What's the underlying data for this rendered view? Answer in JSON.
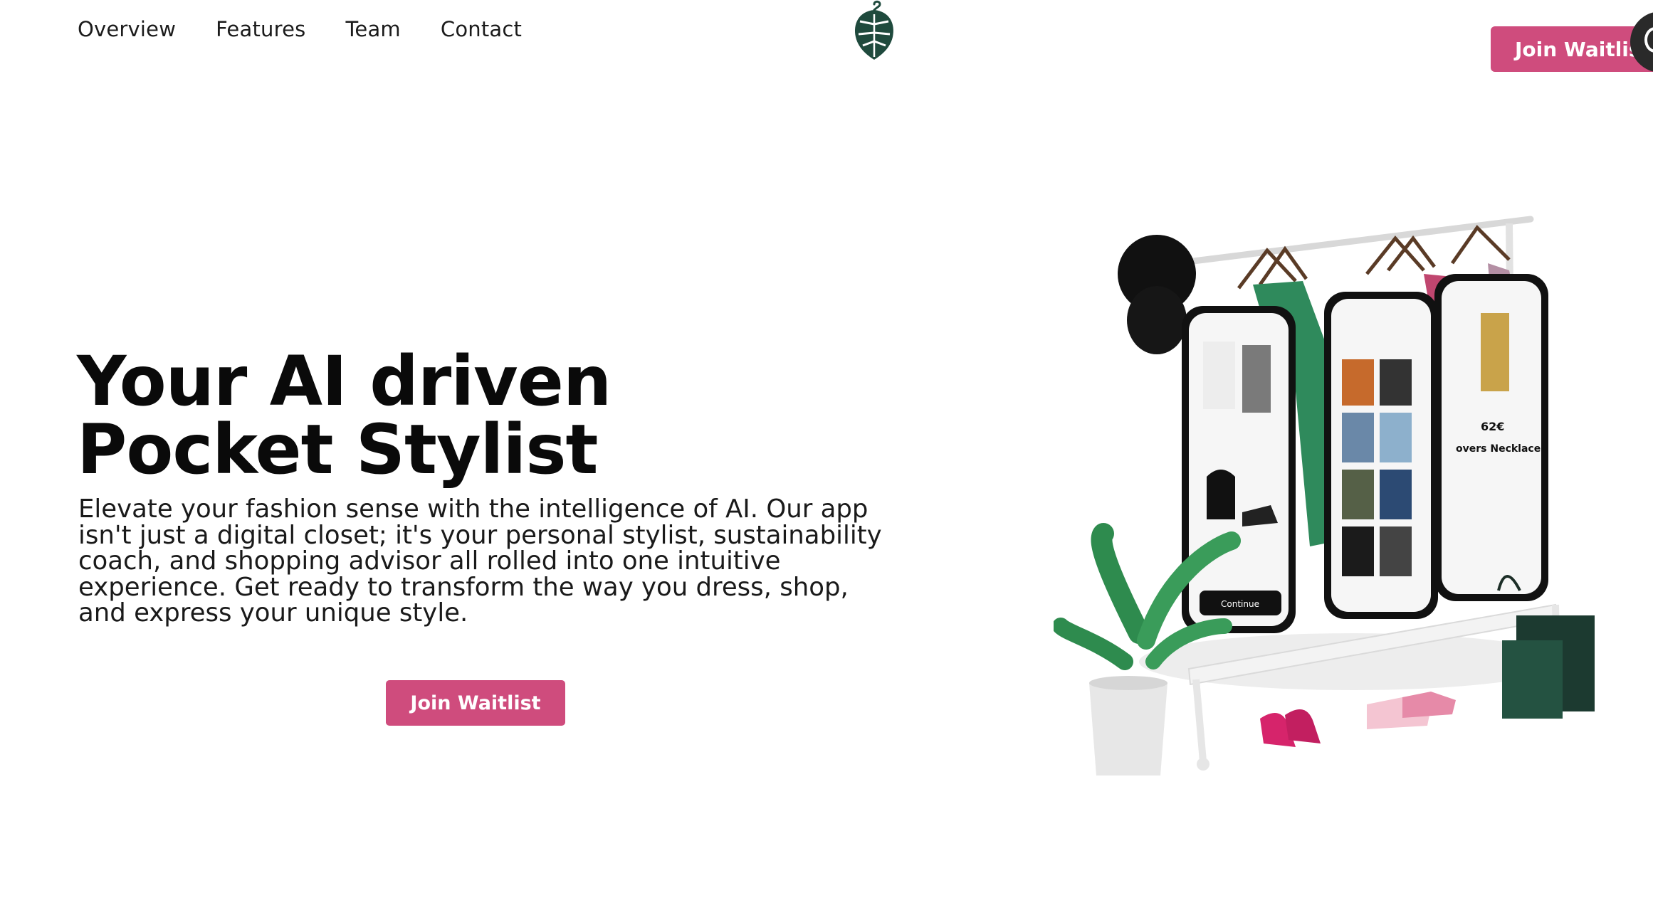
{
  "nav": {
    "items": [
      {
        "label": "Overview"
      },
      {
        "label": "Features"
      },
      {
        "label": "Team"
      },
      {
        "label": "Contact"
      }
    ]
  },
  "header": {
    "cta_label": "Join Waitlist"
  },
  "hero": {
    "title_line1": "Your AI driven",
    "title_line2": "Pocket Stylist",
    "description": "Elevate your fashion sense with the intelligence of AI. Our app isn't just a digital closet; it's your personal stylist, sustainability coach, and shopping advisor all rolled into one intuitive experience. Get ready to transform the way you dress, shop, and express your unique style.",
    "cta_label": "Join Waitlist"
  },
  "illustration": {
    "phone3_price": "62€",
    "phone3_product": "overs Necklace",
    "phone1_button": "Continue"
  },
  "colors": {
    "accent": "#cf4c7d",
    "logo_green": "#1f4a3d",
    "plant_green": "#2e8b4e",
    "jacket_green": "#2f8a5c",
    "shirt_pink": "#c0466f"
  },
  "icons": {
    "logo": "monstera-leaf-hanger-icon",
    "corner": "chat-bubble-icon"
  }
}
